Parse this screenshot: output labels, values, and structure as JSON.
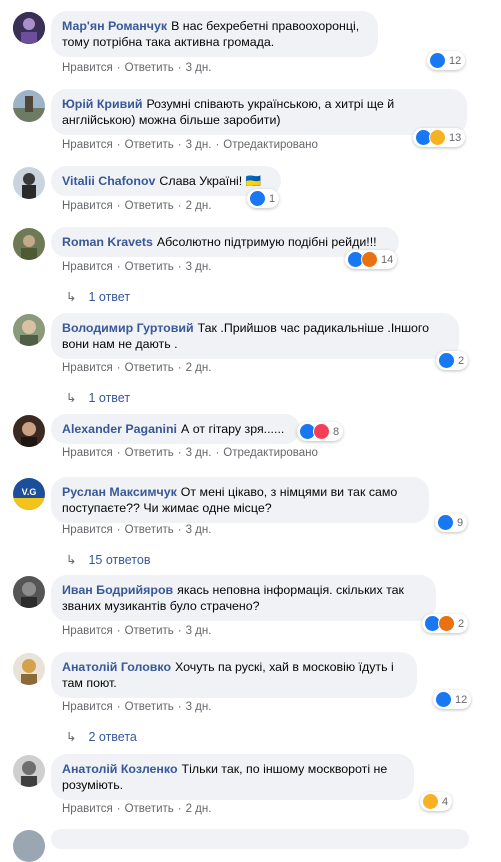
{
  "labels": {
    "like": "Нравится",
    "reply": "Ответить",
    "edited": "Отредактировано",
    "sep": "·"
  },
  "comments": [
    {
      "author": "Мар'ян Романчук",
      "text": "В нас бехребетні правоохоронці, тому потрібна така активна громада.",
      "time": "3 дн.",
      "edited": false,
      "reactions": [
        "like"
      ],
      "count": "12"
    },
    {
      "author": "Юрій Кривий",
      "text": "Розумні співають українською, а хитрі ще й англійською) можна більше заробити)",
      "time": "3 дн.",
      "edited": true,
      "reactions": [
        "like",
        "haha"
      ],
      "count": "13"
    },
    {
      "author": "Vitalii Chafonov",
      "text": "Слава Україні! 🇺🇦",
      "time": "2 дн.",
      "edited": false,
      "reactions": [
        "like"
      ],
      "count": "1"
    },
    {
      "author": "Roman Kravets",
      "text": "Абсолютно підтримую подібні рейди!!!",
      "time": "3 дн.",
      "edited": false,
      "reactions": [
        "like",
        "angry"
      ],
      "count": "14",
      "replies": "1 ответ"
    },
    {
      "author": "Володимир Гуртовий",
      "text": "Так .Прийшов час радикальніше .Іншого вони нам не дають .",
      "time": "2 дн.",
      "edited": false,
      "reactions": [
        "like"
      ],
      "count": "2",
      "replies": "1 ответ"
    },
    {
      "author": "Alexander Paganini",
      "text": "А от гітару зря......",
      "time": "3 дн.",
      "edited": true,
      "reactions": [
        "like",
        "love"
      ],
      "count": "8"
    },
    {
      "author": "Руслан Максимчук",
      "text": "От мені цікаво, з німцями ви так само поступаєте?? Чи жимає одне місце?",
      "time": "3 дн.",
      "edited": false,
      "reactions": [
        "like"
      ],
      "count": "9",
      "replies": "15 ответов"
    },
    {
      "author": "Иван Бодрийяров",
      "text": "якась неповна інформація. скільких так званих музикантів було страчено?",
      "time": "3 дн.",
      "edited": false,
      "reactions": [
        "like",
        "angry"
      ],
      "count": "2"
    },
    {
      "author": "Анатолій Головко",
      "text": "Хочуть па рускі, хай в московію їдуть і там поют.",
      "time": "3 дн.",
      "edited": false,
      "reactions": [
        "like"
      ],
      "count": "12",
      "replies": "2 ответа"
    },
    {
      "author": "Анатолій Козленко",
      "text": "Тільки так, по іншому москвороті не розуміють.",
      "time": "2 дн.",
      "edited": false,
      "reactions": [
        "haha"
      ],
      "count": "4"
    }
  ]
}
